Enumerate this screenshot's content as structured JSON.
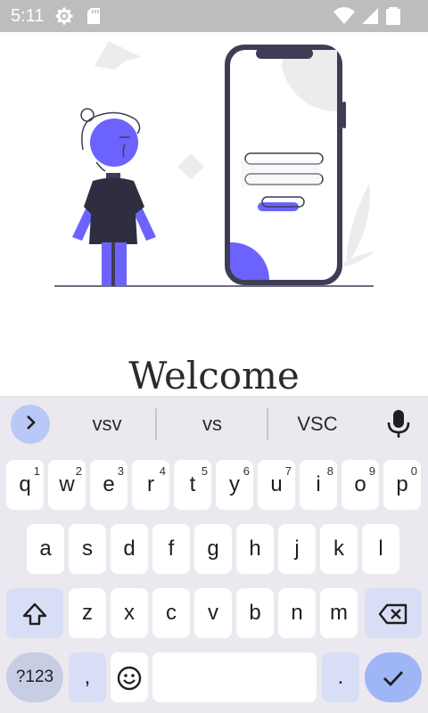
{
  "status_bar": {
    "time": "5:11",
    "left_icons": [
      "settings-icon",
      "sd-card-icon"
    ],
    "right_icons": [
      "wifi-icon",
      "signal-icon",
      "battery-icon"
    ]
  },
  "main": {
    "welcome_text": "Welcome"
  },
  "keyboard": {
    "suggestions": [
      "vsv",
      "vs",
      "VSC"
    ],
    "row1": [
      {
        "label": "q",
        "hint": "1"
      },
      {
        "label": "w",
        "hint": "2"
      },
      {
        "label": "e",
        "hint": "3"
      },
      {
        "label": "r",
        "hint": "4"
      },
      {
        "label": "t",
        "hint": "5"
      },
      {
        "label": "y",
        "hint": "6"
      },
      {
        "label": "u",
        "hint": "7"
      },
      {
        "label": "i",
        "hint": "8"
      },
      {
        "label": "o",
        "hint": "9"
      },
      {
        "label": "p",
        "hint": "0"
      }
    ],
    "row2": [
      "a",
      "s",
      "d",
      "f",
      "g",
      "h",
      "j",
      "k",
      "l"
    ],
    "row3": [
      "z",
      "x",
      "c",
      "v",
      "b",
      "n",
      "m"
    ],
    "symbols_label": "?123",
    "comma_label": ",",
    "period_label": ".",
    "icons": {
      "expand": "chevron-right-icon",
      "mic": "microphone-icon",
      "shift": "shift-icon",
      "backspace": "backspace-icon",
      "emoji": "emoji-icon",
      "enter": "checkmark-icon"
    }
  },
  "colors": {
    "accent": "#6c63ff",
    "dark": "#3f3d56",
    "status_bar": "#bdbdbd",
    "keyboard_bg": "#ece8f0",
    "special_key": "#d8def5",
    "enter_key": "#9eb6f5"
  }
}
